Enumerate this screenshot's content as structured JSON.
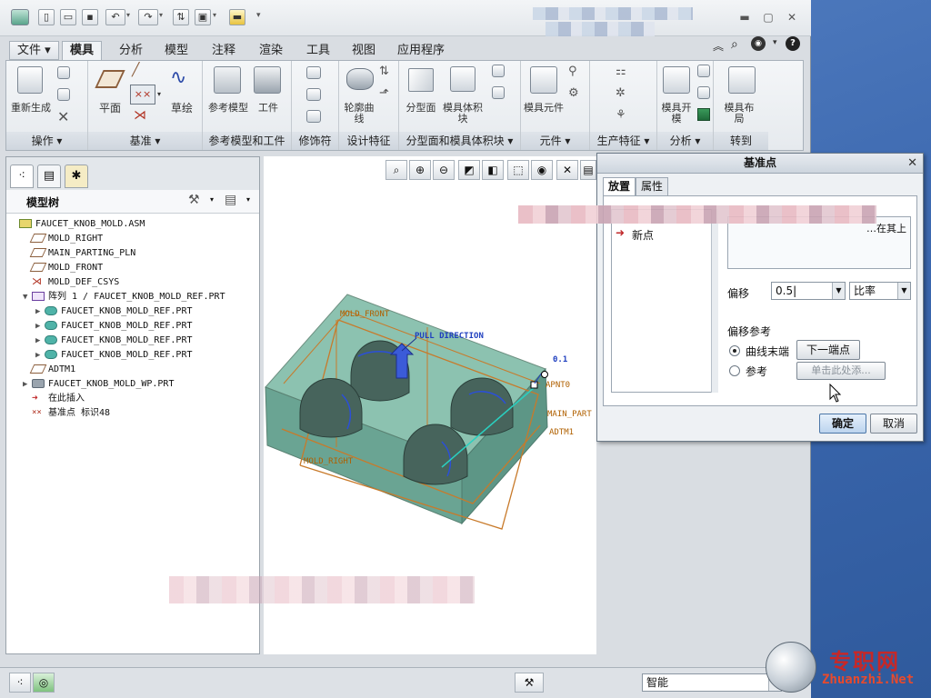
{
  "window": {
    "ribbon_tabs": [
      "文件",
      "模具",
      "分析",
      "模型",
      "注释",
      "渲染",
      "工具",
      "视图",
      "应用程序"
    ]
  },
  "ribbon": {
    "groups": [
      {
        "label": "操作 ▾",
        "buttons": [
          "重新生成"
        ]
      },
      {
        "label": "基准 ▾",
        "buttons": [
          "平面",
          "草绘"
        ]
      },
      {
        "label": "参考模型和工件",
        "buttons": [
          "参考模型",
          "工件"
        ]
      },
      {
        "label": "修饰符",
        "buttons": []
      },
      {
        "label": "设计特征",
        "buttons": [
          "轮廓曲线"
        ]
      },
      {
        "label": "分型面和模具体积块 ▾",
        "buttons": [
          "分型面",
          "模具体积块"
        ]
      },
      {
        "label": "元件 ▾",
        "buttons": [
          "模具元件"
        ]
      },
      {
        "label": "生产特征 ▾",
        "buttons": []
      },
      {
        "label": "分析 ▾",
        "buttons": [
          "模具开模"
        ]
      },
      {
        "label": "转到",
        "buttons": [
          "模具布局"
        ]
      }
    ]
  },
  "model_tree": {
    "title": "模型树",
    "items": [
      {
        "label": "FAUCET_KNOB_MOLD.ASM",
        "icon": "assembly-icon",
        "indent": 0,
        "expand": ""
      },
      {
        "label": "MOLD_RIGHT",
        "icon": "datum-plane-icon",
        "indent": 1,
        "expand": ""
      },
      {
        "label": "MAIN_PARTING_PLN",
        "icon": "datum-plane-icon",
        "indent": 1,
        "expand": ""
      },
      {
        "label": "MOLD_FRONT",
        "icon": "datum-plane-icon",
        "indent": 1,
        "expand": ""
      },
      {
        "label": "MOLD_DEF_CSYS",
        "icon": "csys-icon",
        "indent": 1,
        "expand": ""
      },
      {
        "label": "阵列 1 / FAUCET_KNOB_MOLD_REF.PRT",
        "icon": "pattern-icon",
        "indent": 1,
        "expand": "▼"
      },
      {
        "label": "FAUCET_KNOB_MOLD_REF.PRT",
        "icon": "part-icon",
        "indent": 2,
        "expand": "▶"
      },
      {
        "label": "FAUCET_KNOB_MOLD_REF.PRT",
        "icon": "part-icon",
        "indent": 2,
        "expand": "▶"
      },
      {
        "label": "FAUCET_KNOB_MOLD_REF.PRT",
        "icon": "part-icon",
        "indent": 2,
        "expand": "▶"
      },
      {
        "label": "FAUCET_KNOB_MOLD_REF.PRT",
        "icon": "part-icon",
        "indent": 2,
        "expand": "▶"
      },
      {
        "label": "ADTM1",
        "icon": "datum-plane-icon",
        "indent": 1,
        "expand": ""
      },
      {
        "label": "FAUCET_KNOB_MOLD_WP.PRT",
        "icon": "workpiece-icon",
        "indent": 1,
        "expand": "▶"
      },
      {
        "label": "在此插入",
        "icon": "insert-here-icon",
        "indent": 1,
        "expand": ""
      },
      {
        "label": "基准点 标识48",
        "icon": "datum-point-icon",
        "indent": 1,
        "expand": ""
      }
    ]
  },
  "viewport": {
    "labels": {
      "mold_front": "MOLD_FRONT",
      "pull_direction": "PULL DIRECTION",
      "offset": "0.1",
      "apnt": "APNT0",
      "main_part": "MAIN_PART",
      "adtm": "ADTM1",
      "mold_right": "MOLD_RIGHT"
    }
  },
  "dialog": {
    "title": "基准点",
    "tabs": [
      "放置",
      "属性"
    ],
    "points_list": [
      "新点"
    ],
    "placement_text": "…在其上",
    "offset_label": "偏移",
    "offset_value": "0.5",
    "offset_type": "比率",
    "offset_ref_label": "偏移参考",
    "radio_curve_end": "曲线末端",
    "next_end_button": "下一端点",
    "radio_reference": "参考",
    "click_here_button": "单击此处添...",
    "ok_button": "确定",
    "cancel_button": "取消"
  },
  "statusbar": {
    "filter_value": "智能"
  },
  "watermark": {
    "cn": "专职网",
    "en": "Zhuanzhi.Net"
  },
  "colors": {
    "workpiece": "#7fb7a6",
    "mold_outline": "#c87a2a",
    "datum_text": "#b06000",
    "accent_blue": "#1f3fbf"
  }
}
